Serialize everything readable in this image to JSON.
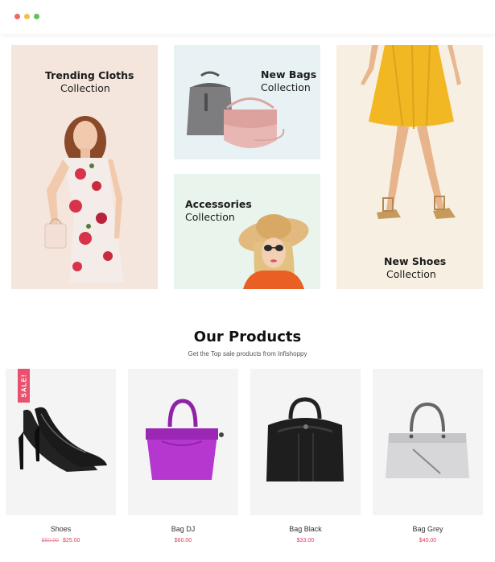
{
  "colors": {
    "chrome_red": "#ee6a5f",
    "chrome_yellow": "#f5be4f",
    "chrome_green": "#61c454",
    "banner_trending_bg": "#f4e5dd",
    "banner_bags_bg": "#e8f2f4",
    "banner_accessories_bg": "#e9f4ec",
    "banner_shoes_bg": "#f7efe2",
    "product_card_bg": "#f4f4f4",
    "sale_badge": "#e8516d",
    "price_accent": "#d8415e"
  },
  "banners": [
    {
      "title": "Trending Cloths",
      "subtitle": "Collection",
      "image_icon": "woman-floral-dress-image"
    },
    {
      "title": "New Bags",
      "subtitle": "Collection",
      "image_icon": "handbags-image"
    },
    {
      "title": "Accessories",
      "subtitle": "Collection",
      "image_icon": "woman-sunhat-image"
    },
    {
      "title": "New Shoes",
      "subtitle": "Collection",
      "image_icon": "legs-sandals-image"
    }
  ],
  "products_section": {
    "title": "Our Products",
    "subtitle": "Get the Top sale products from Infishoppy"
  },
  "products": [
    {
      "name": "Shoes",
      "old_price": "$50.00",
      "price": "$25.00",
      "badge": "SALE!",
      "image_icon": "black-heels-image"
    },
    {
      "name": "Bag DJ",
      "old_price": "",
      "price": "$60.00",
      "badge": "",
      "image_icon": "purple-handbag-image"
    },
    {
      "name": "Bag Black",
      "old_price": "",
      "price": "$33.00",
      "badge": "",
      "image_icon": "black-backpack-image"
    },
    {
      "name": "Bag Grey",
      "old_price": "",
      "price": "$40.00",
      "badge": "",
      "image_icon": "grey-handbag-image"
    }
  ]
}
